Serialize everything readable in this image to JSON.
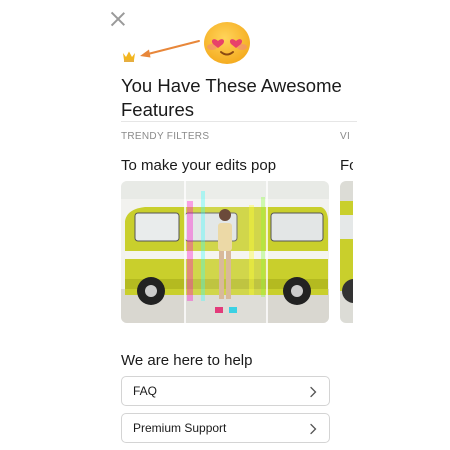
{
  "header": {
    "close_icon": "close-icon",
    "crown_icon": "crown-icon",
    "arrow_icon": "arrow-icon",
    "emoji_icon": "heart-eyes-emoji",
    "title": "You Have These Awesome Features"
  },
  "features": [
    {
      "category": "TRENDY FILTERS",
      "heading": "To make your edits pop"
    },
    {
      "category": "VI",
      "heading": "Fo"
    }
  ],
  "help": {
    "title": "We are here to help",
    "items": [
      {
        "label": "FAQ"
      },
      {
        "label": "Premium Support"
      }
    ]
  },
  "colors": {
    "accent_arrow": "#e8873a",
    "crown": "#f2b51f",
    "van_body": "#c9cf2c"
  }
}
